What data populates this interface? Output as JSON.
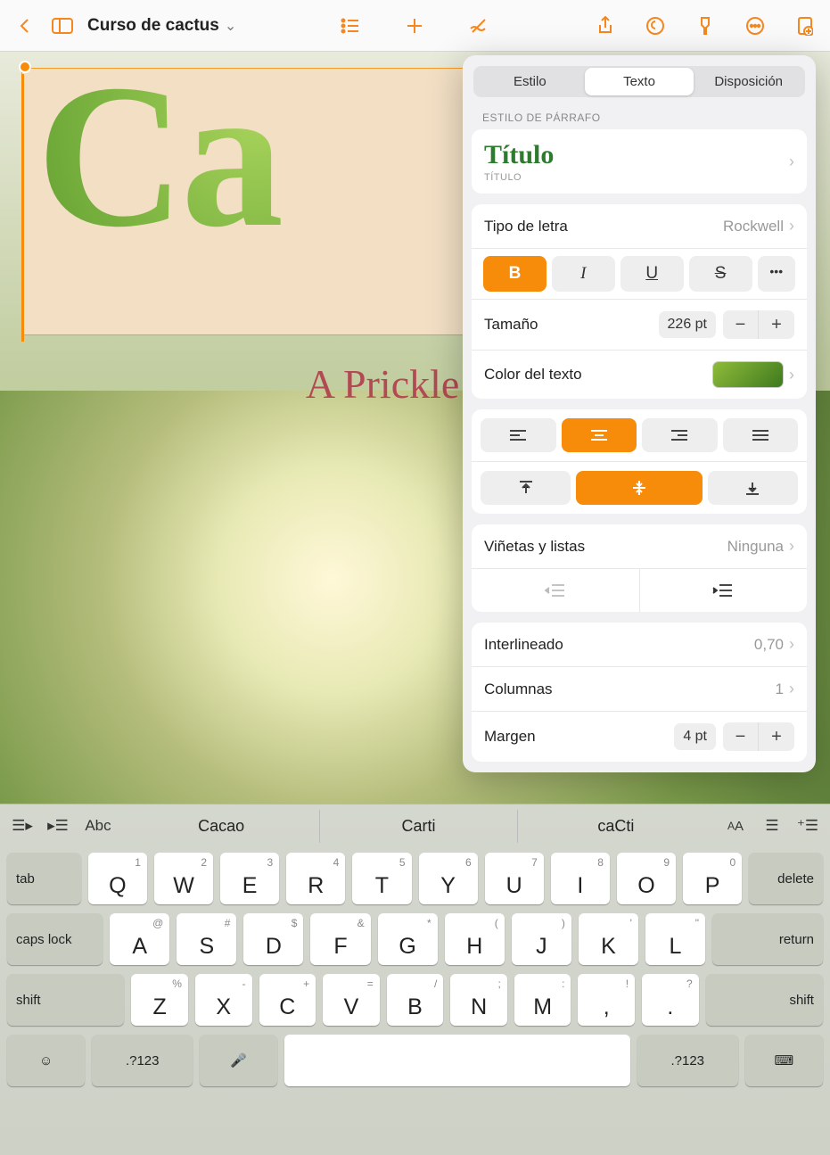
{
  "toolbar": {
    "doc_title": "Curso de cactus"
  },
  "popover": {
    "tabs": {
      "style": "Estilo",
      "text": "Texto",
      "layout": "Disposición"
    },
    "section_label": "ESTILO DE PÁRRAFO",
    "paragraph_style": {
      "name": "Título",
      "sub": "TÍTULO"
    },
    "font": {
      "label": "Tipo de letra",
      "value": "Rockwell"
    },
    "biu": {
      "b": "B",
      "i": "I",
      "u": "U",
      "s": "S",
      "more": "•••"
    },
    "size": {
      "label": "Tamaño",
      "value": "226 pt"
    },
    "color": {
      "label": "Color del texto"
    },
    "bullets": {
      "label": "Viñetas y listas",
      "value": "Ninguna"
    },
    "linespacing": {
      "label": "Interlineado",
      "value": "0,70"
    },
    "columns": {
      "label": "Columnas",
      "value": "1"
    },
    "margin": {
      "label": "Margen",
      "value": "4 pt"
    }
  },
  "doc": {
    "big_title": "Ca",
    "subtitle": "A Prickle Fre"
  },
  "kbd": {
    "sugg1": "Cacao",
    "sugg2": "Carti",
    "sugg3": "caCti",
    "abc": "Abc",
    "row1": [
      {
        "k": "Q",
        "h": "1"
      },
      {
        "k": "W",
        "h": "2"
      },
      {
        "k": "E",
        "h": "3"
      },
      {
        "k": "R",
        "h": "4"
      },
      {
        "k": "T",
        "h": "5"
      },
      {
        "k": "Y",
        "h": "6"
      },
      {
        "k": "U",
        "h": "7"
      },
      {
        "k": "I",
        "h": "8"
      },
      {
        "k": "O",
        "h": "9"
      },
      {
        "k": "P",
        "h": "0"
      }
    ],
    "row2": [
      {
        "k": "A",
        "h": "@"
      },
      {
        "k": "S",
        "h": "#"
      },
      {
        "k": "D",
        "h": "$"
      },
      {
        "k": "F",
        "h": "&"
      },
      {
        "k": "G",
        "h": "*"
      },
      {
        "k": "H",
        "h": "("
      },
      {
        "k": "J",
        "h": ")"
      },
      {
        "k": "K",
        "h": "'"
      },
      {
        "k": "L",
        "h": "\""
      }
    ],
    "row3": [
      {
        "k": "Z",
        "h": "%"
      },
      {
        "k": "X",
        "h": "-"
      },
      {
        "k": "C",
        "h": "+"
      },
      {
        "k": "V",
        "h": "="
      },
      {
        "k": "B",
        "h": "/"
      },
      {
        "k": "N",
        "h": ";"
      },
      {
        "k": "M",
        "h": ":"
      },
      {
        "k": ",",
        "h": "!"
      },
      {
        "k": ".",
        "h": "?"
      }
    ],
    "tab": "tab",
    "del": "delete",
    "caps": "caps lock",
    "ret": "return",
    "shift": "shift",
    "numsym": ".?123"
  }
}
